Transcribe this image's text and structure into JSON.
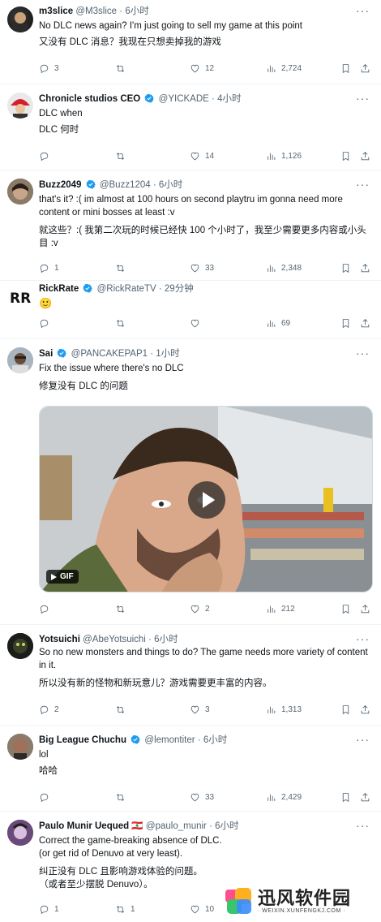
{
  "tweets": [
    {
      "name": "m3slice",
      "handle": "@M3slice",
      "time": "6小时",
      "text_en": "No DLC news again? I'm just going to sell my game at this point",
      "text_zh": "又没有 DLC 消息？我现在只想卖掉我的游戏",
      "replies": "3",
      "retweets": "",
      "likes": "12",
      "views": "2,724"
    },
    {
      "name": "Chronicle studios CEO",
      "handle": "@YICKADE",
      "time": "4小时",
      "text_en": "DLC when",
      "text_zh": "DLC 何时",
      "replies": "",
      "retweets": "",
      "likes": "14",
      "views": "1,126"
    },
    {
      "name": "Buzz2049",
      "handle": "@Buzz1204",
      "time": "6小时",
      "text_en": "that's it? :( im almost at 100 hours on second playtru im gonna need more content or mini bosses at least :v",
      "text_zh": "就这些？:( 我第二次玩的时候已经快 100 个小时了，我至少需要更多内容或小头目 :v",
      "replies": "1",
      "retweets": "",
      "likes": "33",
      "views": "2,348"
    },
    {
      "name": "RickRate",
      "handle": "@RickRateTV",
      "time": "29分钟",
      "text_en": "🙂",
      "replies": "",
      "retweets": "",
      "likes": "",
      "views": "69"
    },
    {
      "name": "Sai",
      "handle": "@PANCAKEPAP1",
      "time": "1小时",
      "text_en": "Fix the issue where there's no DLC",
      "text_zh": "修复没有 DLC 的问题",
      "media_badge": "GIF",
      "replies": "",
      "retweets": "",
      "likes": "2",
      "views": "212"
    },
    {
      "name": "Yotsuichi",
      "handle": "@AbeYotsuichi",
      "time": "6小时",
      "text_en": "So no new monsters and things to do? The game needs more variety of content in it.",
      "text_zh": "所以没有新的怪物和新玩意儿？游戏需要更丰富的内容。",
      "replies": "2",
      "retweets": "",
      "likes": "3",
      "views": "1,313"
    },
    {
      "name": "Big League Chuchu",
      "handle": "@lemontiter",
      "time": "6小时",
      "text_en": "lol",
      "text_zh": "哈哈",
      "replies": "",
      "retweets": "",
      "likes": "33",
      "views": "2,429"
    },
    {
      "name": "Paulo Munir Uequed",
      "flag": "🇱🇧",
      "handle": "@paulo_munir",
      "time": "6小时",
      "text_en1": "Correct the game-breaking absence of DLC.",
      "text_en2": "(or get rid of Denuvo at very least).",
      "text_zh1": "纠正没有 DLC 且影响游戏体验的问题。",
      "text_zh2": "（或者至少摆脱 Denuvo）。",
      "replies": "1",
      "retweets": "1",
      "likes": "10",
      "views": ""
    }
  ],
  "watermark": {
    "title": "迅风软件园",
    "subtitle": "· WEIXIN.XUNFENGKJ.COM ·"
  },
  "colors": {
    "text": "#0f1419",
    "secondary": "#536471",
    "verified": "#1d9bf0",
    "divider": "#eff3f4"
  }
}
